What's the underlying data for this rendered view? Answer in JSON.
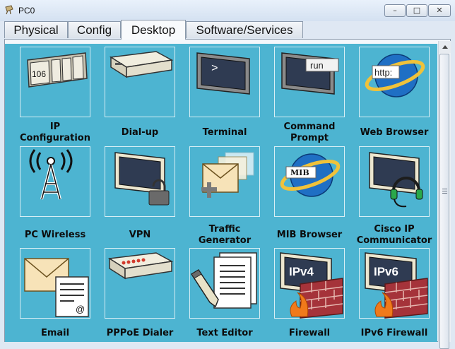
{
  "window": {
    "title": "PC0"
  },
  "tabs": [
    {
      "label": "Physical"
    },
    {
      "label": "Config"
    },
    {
      "label": "Desktop"
    },
    {
      "label": "Software/Services"
    }
  ],
  "apps": [
    {
      "label1": "IP",
      "label2": "Configuration",
      "badge": "106",
      "icon": "ip-configuration-icon"
    },
    {
      "label1": "Dial-up",
      "icon": "modem-icon"
    },
    {
      "label1": "Terminal",
      "badge": ">",
      "icon": "terminal-icon"
    },
    {
      "label1": "Command",
      "label2": "Prompt",
      "badge": "run",
      "icon": "command-prompt-icon"
    },
    {
      "label1": "Web Browser",
      "badge": "http:",
      "icon": "web-browser-icon"
    },
    {
      "label1": "PC Wireless",
      "icon": "wireless-antenna-icon"
    },
    {
      "label1": "VPN",
      "icon": "vpn-lock-icon"
    },
    {
      "label1": "Traffic",
      "label2": "Generator",
      "icon": "traffic-generator-icon"
    },
    {
      "label1": "MIB Browser",
      "badge": "MIB",
      "icon": "mib-browser-icon"
    },
    {
      "label1": "Cisco IP",
      "label2": "Communicator",
      "icon": "ip-communicator-icon"
    },
    {
      "label1": "Email",
      "badge": "@",
      "icon": "email-icon"
    },
    {
      "label1": "PPPoE Dialer",
      "icon": "pppoe-dialer-icon"
    },
    {
      "label1": "Text Editor",
      "icon": "text-editor-icon"
    },
    {
      "label1": "Firewall",
      "badge": "IPv4",
      "icon": "firewall-icon"
    },
    {
      "label1": "IPv6 Firewall",
      "badge": "IPv6",
      "icon": "ipv6-firewall-icon"
    }
  ],
  "colors": {
    "desktop_bg": "#4db4d1",
    "tile_bg": "#4db4d1"
  }
}
